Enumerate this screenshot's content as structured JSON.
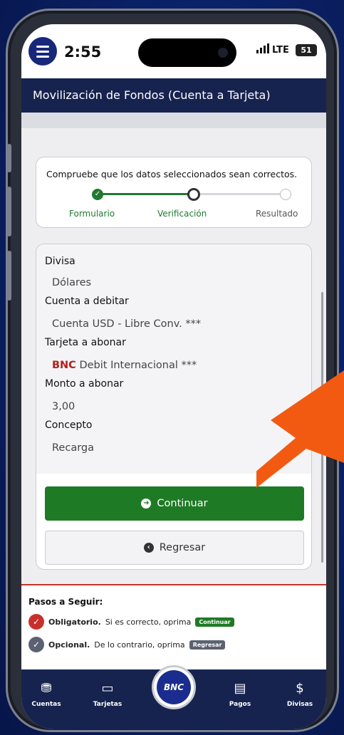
{
  "status": {
    "time": "2:55",
    "network": "LTE",
    "battery": "51"
  },
  "appbar": {
    "title": "Movilización de Fondos (Cuenta a Tarjeta)"
  },
  "stepper": {
    "title": "Compruebe que los datos seleccionados sean correctos.",
    "steps": [
      {
        "label": "Formulario",
        "state": "done"
      },
      {
        "label": "Verificación",
        "state": "current"
      },
      {
        "label": "Resultado",
        "state": "pending"
      }
    ]
  },
  "form": {
    "currency_label": "Divisa",
    "currency_value": "Dólares",
    "debit_label": "Cuenta a debitar",
    "debit_value": "Cuenta USD - Libre Conv. ***",
    "card_label": "Tarjeta a abonar",
    "card_brand": "BNC",
    "card_value": " Debit Internacional ***",
    "amount_label": "Monto a abonar",
    "amount_value": "3,00",
    "concept_label": "Concepto",
    "concept_value": "Recarga"
  },
  "buttons": {
    "continue_label": "Continuar",
    "back_label": "Regresar"
  },
  "guide": {
    "title": "Pasos a Seguir:",
    "required_bold": "Obligatorio.",
    "required_text": " Si es correcto, oprima",
    "required_btn": "Continuar",
    "optional_bold": "Opcional.",
    "optional_text": " De lo contrario, oprima",
    "optional_btn": "Regresar"
  },
  "nav": {
    "items": [
      {
        "label": "Cuentas"
      },
      {
        "label": "Tarjetas"
      },
      {
        "label": "Pagos"
      },
      {
        "label": "Divisas"
      }
    ],
    "logo_text": "BNC"
  },
  "colors": {
    "navy": "#16234f",
    "green": "#1f7a25",
    "red": "#c9302c",
    "orange_arrow": "#f25a12"
  }
}
